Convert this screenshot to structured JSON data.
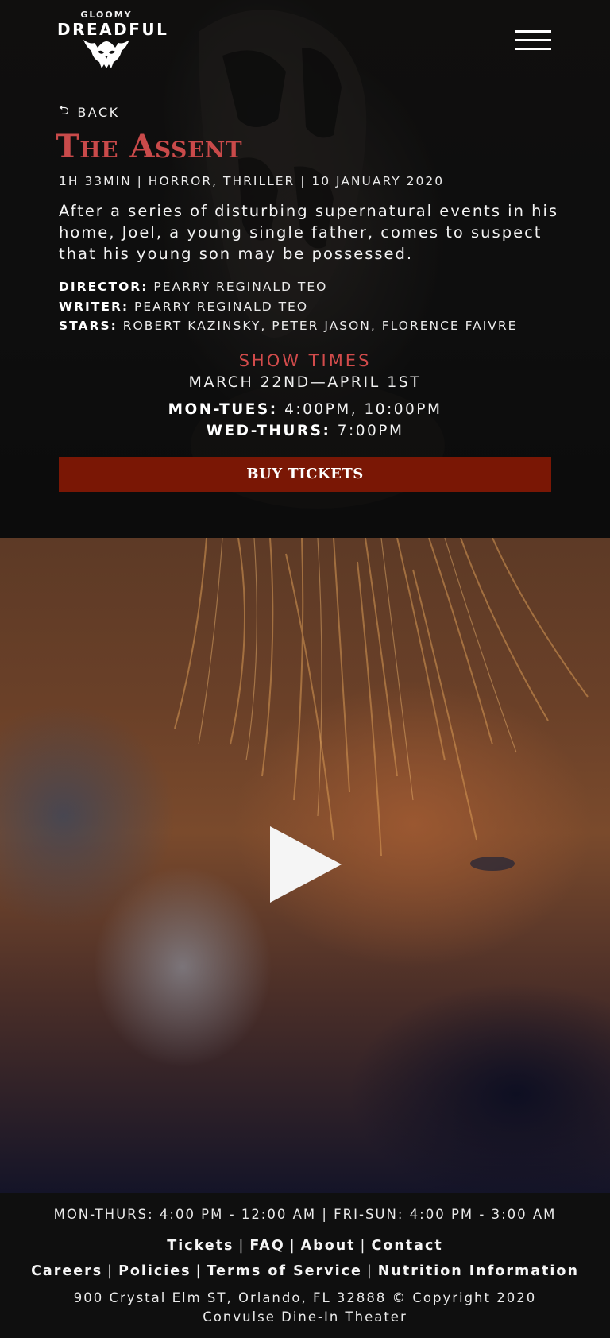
{
  "header": {
    "logo_top": "GLOOMY",
    "logo_main": "DREADFUL",
    "menu_icon": "hamburger-icon"
  },
  "nav": {
    "back_label": "BACK",
    "back_icon": "back-arrow-icon"
  },
  "movie": {
    "title": "The Assent",
    "meta": "1H 33MIN | HORROR, THRILLER | 10 JANUARY 2020",
    "synopsis": "After a series of disturbing supernatural events in his home, Joel, a young single father, comes to suspect that his young son may be possessed.",
    "credits": [
      {
        "label": "DIRECTOR:",
        "value": "PEARRY REGINALD TEO"
      },
      {
        "label": "WRITER:",
        "value": "PEARRY REGINALD TEO"
      },
      {
        "label": "STARS:",
        "value": "ROBERT KAZINSKY, PETER JASON, FLORENCE FAIVRE"
      }
    ]
  },
  "showtimes": {
    "heading": "SHOW TIMES",
    "dates": "MARCH 22ND—APRIL 1ST",
    "schedule": [
      {
        "days": "MON-TUES:",
        "times": "4:00PM, 10:00PM"
      },
      {
        "days": "WED-THURS:",
        "times": "7:00PM"
      }
    ]
  },
  "buy_button": "BUY TICKETS",
  "video": {
    "play_icon": "play-icon"
  },
  "footer": {
    "hours": "MON-THURS: 4:00 PM - 12:00 AM | FRI-SUN: 4:00 PM - 3:00 AM",
    "nav_primary": [
      "Tickets",
      "FAQ",
      "About",
      "Contact"
    ],
    "nav_secondary": [
      "Careers",
      "Policies",
      "Terms of Service",
      "Nutrition Information"
    ],
    "address_line1": "900 Crystal Elm ST, Orlando, FL 32888 © Copyright 2020",
    "address_line2": "Convulse Dine-In Theater"
  },
  "colors": {
    "accent_red": "#c94a4a",
    "button_red": "#7a1705",
    "background": "#0e0e0e"
  }
}
